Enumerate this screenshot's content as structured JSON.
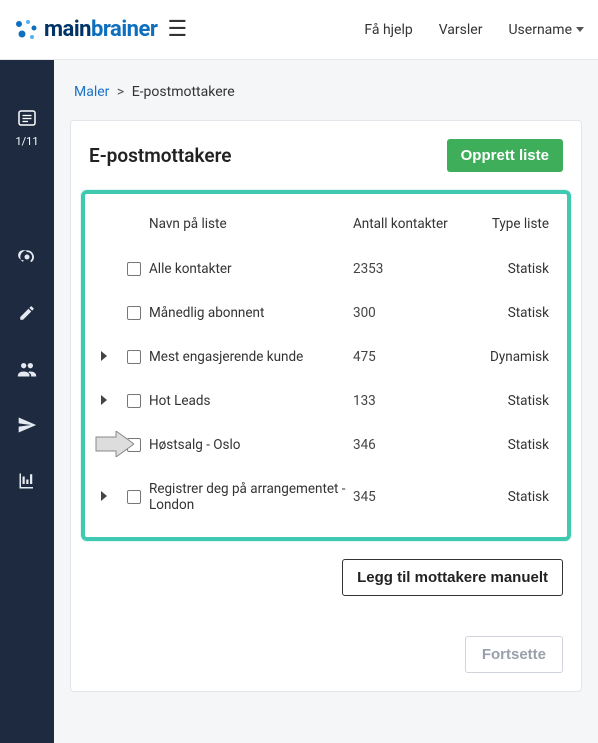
{
  "logo": {
    "main": "main",
    "brainer": "brainer"
  },
  "topnav": {
    "help": "Få hjelp",
    "alerts": "Varsler",
    "username": "Username"
  },
  "sidebar": {
    "step": "1/11"
  },
  "breadcrumb": {
    "root": "Maler",
    "sep": ">",
    "current": "E-postmottakere"
  },
  "card": {
    "title": "E-postmottakere",
    "create_btn": "Opprett liste",
    "columns": {
      "name": "Navn på liste",
      "count": "Antall kontakter",
      "type": "Type liste"
    },
    "rows": [
      {
        "expandable": false,
        "name": "Alle kontakter",
        "count": "2353",
        "type": "Statisk"
      },
      {
        "expandable": false,
        "name": "Månedlig abonnent",
        "count": "300",
        "type": "Statisk"
      },
      {
        "expandable": true,
        "name": "Mest engasjerende kunde",
        "count": "475",
        "type": "Dynamisk"
      },
      {
        "expandable": true,
        "name": "Hot Leads",
        "count": "133",
        "type": "Statisk"
      },
      {
        "expandable": true,
        "name": "Høstsalg - Oslo",
        "count": "346",
        "type": "Statisk"
      },
      {
        "expandable": true,
        "name": "Registrer deg på arrangementet - London",
        "count": "345",
        "type": "Statisk"
      }
    ],
    "add_manual_btn": "Legg til mottakere manuelt",
    "continue_btn": "Fortsette"
  }
}
